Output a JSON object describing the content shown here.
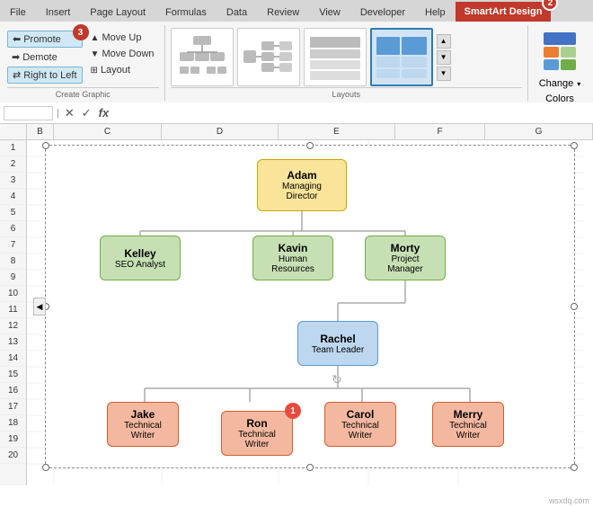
{
  "tabs": {
    "items": [
      {
        "label": "File",
        "active": false
      },
      {
        "label": "Insert",
        "active": false
      },
      {
        "label": "Page Layout",
        "active": false
      },
      {
        "label": "Formulas",
        "active": false
      },
      {
        "label": "Data",
        "active": false
      },
      {
        "label": "Review",
        "active": false
      },
      {
        "label": "View",
        "active": false
      },
      {
        "label": "Developer",
        "active": false
      },
      {
        "label": "Help",
        "active": false
      },
      {
        "label": "SmartArt Design",
        "active": true
      }
    ]
  },
  "ribbon": {
    "create_graphic": {
      "label": "Create Graphic",
      "promote": "Promote",
      "demote": "Demote",
      "move_up": "Move Up",
      "move_down": "Move Down",
      "right_to_left": "Right to Left",
      "layout": "Layout"
    },
    "layouts": {
      "label": "Layouts"
    },
    "colors": {
      "label": "Colors",
      "change": "Change",
      "dropdown": "▾"
    }
  },
  "formula_bar": {
    "name_box": "",
    "cancel": "✕",
    "confirm": "✓",
    "fx": "fx"
  },
  "columns": [
    "B",
    "C",
    "D",
    "E",
    "F",
    "G"
  ],
  "rows": [
    "1",
    "2",
    "3",
    "4",
    "5",
    "6",
    "7",
    "8",
    "9",
    "10",
    "11",
    "12",
    "13",
    "14",
    "15",
    "16",
    "17",
    "18",
    "19",
    "20"
  ],
  "diagram": {
    "nodes": {
      "adam": {
        "name": "Adam",
        "title": "Managing\nDirector"
      },
      "kelley": {
        "name": "Kelley",
        "title": "SEO Analyst"
      },
      "kavin": {
        "name": "Kavin",
        "title": "Human\nResources"
      },
      "morty": {
        "name": "Morty",
        "title": "Project\nManager"
      },
      "rachel": {
        "name": "Rachel",
        "title": "Team Leader"
      },
      "jake": {
        "name": "Jake",
        "title": "Technical\nWriter"
      },
      "ron": {
        "name": "Ron",
        "title": "Technical\nWriter"
      },
      "carol": {
        "name": "Carol",
        "title": "Technical\nWriter"
      },
      "merry": {
        "name": "Merry",
        "title": "Technical\nWriter"
      }
    }
  },
  "callouts": {
    "one": "1",
    "two": "2",
    "three": "3"
  },
  "colors_palette": [
    [
      "#4472c4",
      "#ed7d31",
      "#a9d18e"
    ],
    [
      "#5b9bd5",
      "#70ad47",
      "#ffc000"
    ]
  ]
}
